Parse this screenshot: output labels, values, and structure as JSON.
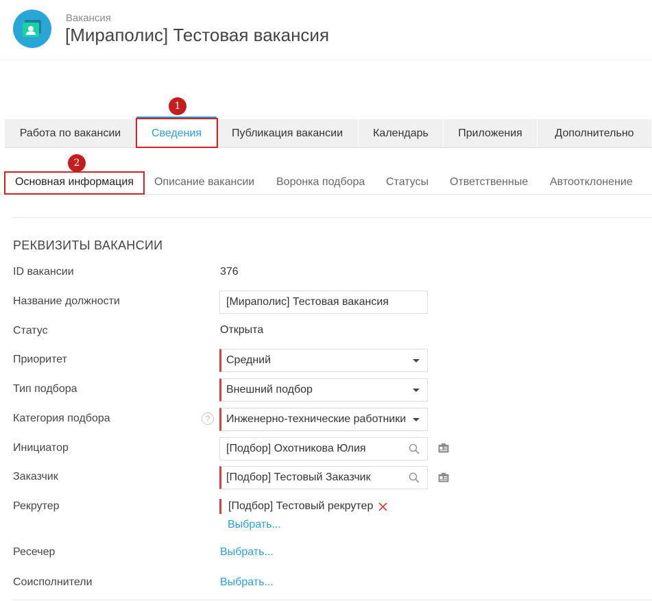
{
  "header": {
    "overline": "Вакансия",
    "title": "[Мираполис] Тестовая вакансия",
    "avatar_icon": "vacancy-card-icon",
    "avatar_color": "#2aa6d6"
  },
  "tabs": [
    {
      "label": "Работа по вакансии",
      "active": false
    },
    {
      "label": "Сведения",
      "active": true
    },
    {
      "label": "Публикация вакансии",
      "active": false
    },
    {
      "label": "Календарь",
      "active": false
    },
    {
      "label": "Приложения",
      "active": false
    },
    {
      "label": "Дополнительно",
      "active": false
    }
  ],
  "subtabs": [
    {
      "label": "Основная информация",
      "active": true
    },
    {
      "label": "Описание вакансии",
      "active": false
    },
    {
      "label": "Воронка подбора",
      "active": false
    },
    {
      "label": "Статусы",
      "active": false
    },
    {
      "label": "Ответственные",
      "active": false
    },
    {
      "label": "Автоотклонение",
      "active": false
    }
  ],
  "annotations": {
    "badge1": "1",
    "badge2": "2"
  },
  "section": {
    "title": "РЕКВИЗИТЫ ВАКАНСИИ"
  },
  "fields": {
    "id": {
      "label": "ID вакансии",
      "value": "376"
    },
    "position": {
      "label": "Название должности",
      "value": "[Мираполис] Тестовая вакансия"
    },
    "status": {
      "label": "Статус",
      "value": "Открыта"
    },
    "priority": {
      "label": "Приоритет",
      "value": "Средний"
    },
    "selection_type": {
      "label": "Тип подбора",
      "value": "Внешний подбор"
    },
    "selection_category": {
      "label": "Категория подбора",
      "value": "Инженерно-технические работники",
      "help": "?"
    },
    "initiator": {
      "label": "Инициатор",
      "value": "[Подбор] Охотникова Юлия"
    },
    "customer": {
      "label": "Заказчик",
      "value": "[Подбор] Тестовый Заказчик"
    },
    "recruiter": {
      "label": "Рекрутер",
      "value": "[Подбор] Тестовый рекрутер",
      "select_link": "Выбрать..."
    },
    "researcher": {
      "label": "Ресечер",
      "select_link": "Выбрать..."
    },
    "coexecutors": {
      "label": "Соисполнители",
      "select_link": "Выбрать..."
    }
  },
  "colors": {
    "accent": "#2a9fd6",
    "required": "#e23b3b",
    "annotation": "#d42020"
  }
}
